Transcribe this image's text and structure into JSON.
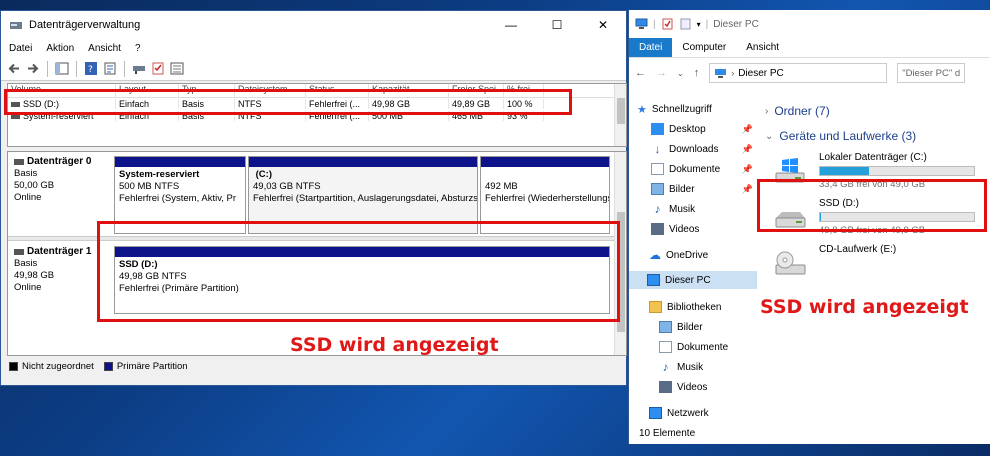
{
  "dm": {
    "title": "Datenträgerverwaltung",
    "menu": [
      "Datei",
      "Aktion",
      "Ansicht",
      "?"
    ],
    "columns": [
      "Volume",
      "Layout",
      "Typ",
      "Dateisystem",
      "Status",
      "Kapazität",
      "Freier Spei...",
      "% frei"
    ],
    "rows": [
      [
        "SSD (D:)",
        "Einfach",
        "Basis",
        "NTFS",
        "Fehlerfrei (...",
        "49,98 GB",
        "49,89 GB",
        "100 %"
      ],
      [
        "System-reserviert",
        "Einfach",
        "Basis",
        "NTFS",
        "Fehlerfrei (...",
        "500 MB",
        "465 MB",
        "93 %"
      ]
    ],
    "disk0": {
      "label": "Datenträger 0",
      "type": "Basis",
      "size": "50,00 GB",
      "state": "Online",
      "parts": [
        {
          "name": "System-reserviert",
          "size": "500 MB NTFS",
          "status": "Fehlerfrei (System, Aktiv, Pr"
        },
        {
          "name": "(C:)",
          "size": "49,03 GB NTFS",
          "status": "Fehlerfrei (Startpartition, Auslagerungsdatei, Absturzs"
        },
        {
          "name": "",
          "size": "492 MB",
          "status": "Fehlerfrei (Wiederherstellungsp"
        }
      ]
    },
    "disk1": {
      "label": "Datenträger 1",
      "type": "Basis",
      "size": "49,98 GB",
      "state": "Online",
      "part": {
        "name": "SSD  (D:)",
        "size": "49,98 GB NTFS",
        "status": "Fehlerfrei (Primäre Partition)"
      }
    },
    "legend": {
      "unalloc": "Nicht zugeordnet",
      "primary": "Primäre Partition"
    },
    "annotation": "SSD wird angezeigt"
  },
  "ex": {
    "title": "Dieser PC",
    "tabs": [
      "Datei",
      "Computer",
      "Ansicht"
    ],
    "address": "Dieser PC",
    "search": "\"Dieser PC\" d",
    "nav": {
      "quick": "Schnellzugriff",
      "desktop": "Desktop",
      "downloads": "Downloads",
      "documents": "Dokumente",
      "pictures": "Bilder",
      "music": "Musik",
      "videos": "Videos",
      "onedrive": "OneDrive",
      "thispc": "Dieser PC",
      "libraries": "Bibliotheken",
      "lib_pictures": "Bilder",
      "lib_documents": "Dokumente",
      "lib_music": "Musik",
      "lib_videos": "Videos",
      "network": "Netzwerk"
    },
    "folders_group": "Ordner (7)",
    "drives_group": "Geräte und Laufwerke (3)",
    "drives": [
      {
        "name": "Lokaler Datenträger (C:)",
        "free": "33,4 GB frei von 49,0 GB",
        "used_fraction": 0.32
      },
      {
        "name": "SSD (D:)",
        "free": "49,8 GB frei von 49,9 GB",
        "used_fraction": 0.002
      },
      {
        "name": "CD-Laufwerk (E:)"
      }
    ],
    "status": "10 Elemente",
    "annotation": "SSD wird angezeigt"
  },
  "colors": {
    "primary_partition": "#0d148a",
    "accent": "#1979ca",
    "annotation": "#e01818",
    "drive_bar": "#26a0da"
  }
}
